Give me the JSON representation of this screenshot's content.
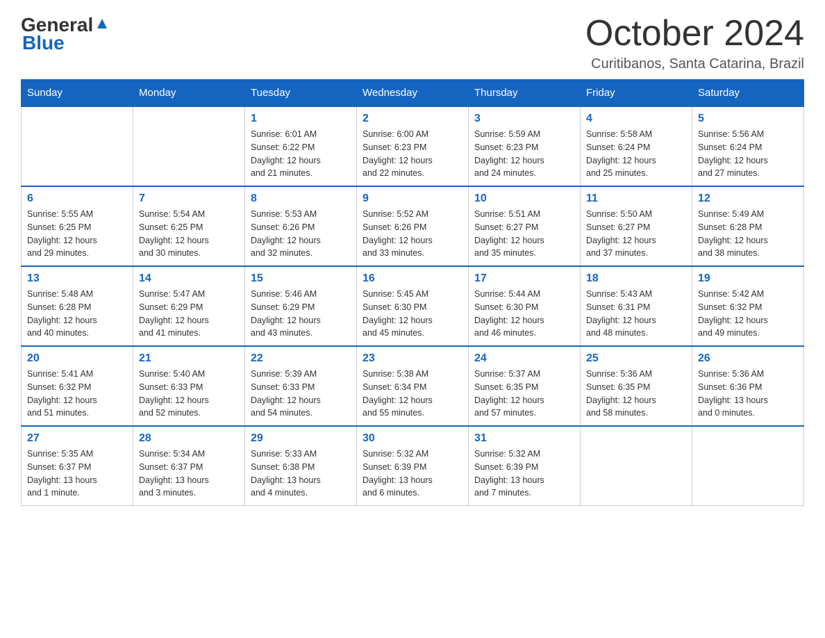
{
  "header": {
    "logo_general": "General",
    "logo_blue": "Blue",
    "month": "October 2024",
    "location": "Curitibanos, Santa Catarina, Brazil"
  },
  "weekdays": [
    "Sunday",
    "Monday",
    "Tuesday",
    "Wednesday",
    "Thursday",
    "Friday",
    "Saturday"
  ],
  "weeks": [
    [
      {
        "day": "",
        "info": ""
      },
      {
        "day": "",
        "info": ""
      },
      {
        "day": "1",
        "info": "Sunrise: 6:01 AM\nSunset: 6:22 PM\nDaylight: 12 hours\nand 21 minutes."
      },
      {
        "day": "2",
        "info": "Sunrise: 6:00 AM\nSunset: 6:23 PM\nDaylight: 12 hours\nand 22 minutes."
      },
      {
        "day": "3",
        "info": "Sunrise: 5:59 AM\nSunset: 6:23 PM\nDaylight: 12 hours\nand 24 minutes."
      },
      {
        "day": "4",
        "info": "Sunrise: 5:58 AM\nSunset: 6:24 PM\nDaylight: 12 hours\nand 25 minutes."
      },
      {
        "day": "5",
        "info": "Sunrise: 5:56 AM\nSunset: 6:24 PM\nDaylight: 12 hours\nand 27 minutes."
      }
    ],
    [
      {
        "day": "6",
        "info": "Sunrise: 5:55 AM\nSunset: 6:25 PM\nDaylight: 12 hours\nand 29 minutes."
      },
      {
        "day": "7",
        "info": "Sunrise: 5:54 AM\nSunset: 6:25 PM\nDaylight: 12 hours\nand 30 minutes."
      },
      {
        "day": "8",
        "info": "Sunrise: 5:53 AM\nSunset: 6:26 PM\nDaylight: 12 hours\nand 32 minutes."
      },
      {
        "day": "9",
        "info": "Sunrise: 5:52 AM\nSunset: 6:26 PM\nDaylight: 12 hours\nand 33 minutes."
      },
      {
        "day": "10",
        "info": "Sunrise: 5:51 AM\nSunset: 6:27 PM\nDaylight: 12 hours\nand 35 minutes."
      },
      {
        "day": "11",
        "info": "Sunrise: 5:50 AM\nSunset: 6:27 PM\nDaylight: 12 hours\nand 37 minutes."
      },
      {
        "day": "12",
        "info": "Sunrise: 5:49 AM\nSunset: 6:28 PM\nDaylight: 12 hours\nand 38 minutes."
      }
    ],
    [
      {
        "day": "13",
        "info": "Sunrise: 5:48 AM\nSunset: 6:28 PM\nDaylight: 12 hours\nand 40 minutes."
      },
      {
        "day": "14",
        "info": "Sunrise: 5:47 AM\nSunset: 6:29 PM\nDaylight: 12 hours\nand 41 minutes."
      },
      {
        "day": "15",
        "info": "Sunrise: 5:46 AM\nSunset: 6:29 PM\nDaylight: 12 hours\nand 43 minutes."
      },
      {
        "day": "16",
        "info": "Sunrise: 5:45 AM\nSunset: 6:30 PM\nDaylight: 12 hours\nand 45 minutes."
      },
      {
        "day": "17",
        "info": "Sunrise: 5:44 AM\nSunset: 6:30 PM\nDaylight: 12 hours\nand 46 minutes."
      },
      {
        "day": "18",
        "info": "Sunrise: 5:43 AM\nSunset: 6:31 PM\nDaylight: 12 hours\nand 48 minutes."
      },
      {
        "day": "19",
        "info": "Sunrise: 5:42 AM\nSunset: 6:32 PM\nDaylight: 12 hours\nand 49 minutes."
      }
    ],
    [
      {
        "day": "20",
        "info": "Sunrise: 5:41 AM\nSunset: 6:32 PM\nDaylight: 12 hours\nand 51 minutes."
      },
      {
        "day": "21",
        "info": "Sunrise: 5:40 AM\nSunset: 6:33 PM\nDaylight: 12 hours\nand 52 minutes."
      },
      {
        "day": "22",
        "info": "Sunrise: 5:39 AM\nSunset: 6:33 PM\nDaylight: 12 hours\nand 54 minutes."
      },
      {
        "day": "23",
        "info": "Sunrise: 5:38 AM\nSunset: 6:34 PM\nDaylight: 12 hours\nand 55 minutes."
      },
      {
        "day": "24",
        "info": "Sunrise: 5:37 AM\nSunset: 6:35 PM\nDaylight: 12 hours\nand 57 minutes."
      },
      {
        "day": "25",
        "info": "Sunrise: 5:36 AM\nSunset: 6:35 PM\nDaylight: 12 hours\nand 58 minutes."
      },
      {
        "day": "26",
        "info": "Sunrise: 5:36 AM\nSunset: 6:36 PM\nDaylight: 13 hours\nand 0 minutes."
      }
    ],
    [
      {
        "day": "27",
        "info": "Sunrise: 5:35 AM\nSunset: 6:37 PM\nDaylight: 13 hours\nand 1 minute."
      },
      {
        "day": "28",
        "info": "Sunrise: 5:34 AM\nSunset: 6:37 PM\nDaylight: 13 hours\nand 3 minutes."
      },
      {
        "day": "29",
        "info": "Sunrise: 5:33 AM\nSunset: 6:38 PM\nDaylight: 13 hours\nand 4 minutes."
      },
      {
        "day": "30",
        "info": "Sunrise: 5:32 AM\nSunset: 6:39 PM\nDaylight: 13 hours\nand 6 minutes."
      },
      {
        "day": "31",
        "info": "Sunrise: 5:32 AM\nSunset: 6:39 PM\nDaylight: 13 hours\nand 7 minutes."
      },
      {
        "day": "",
        "info": ""
      },
      {
        "day": "",
        "info": ""
      }
    ]
  ]
}
